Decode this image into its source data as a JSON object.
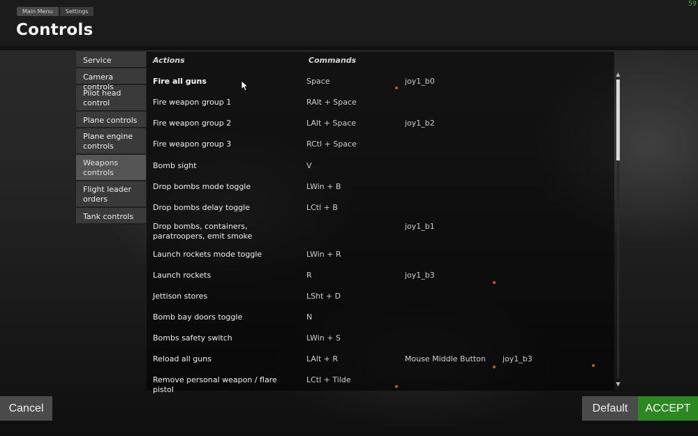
{
  "header": {
    "breadcrumbs": [
      "Main Menu",
      "Settings"
    ],
    "title": "Controls",
    "fps": "59"
  },
  "sidebar": {
    "items": [
      {
        "label": "Service"
      },
      {
        "label": "Camera controls"
      },
      {
        "label": "Pilot head control"
      },
      {
        "label": "Plane controls"
      },
      {
        "label": "Plane engine controls"
      },
      {
        "label": "Weapons controls"
      },
      {
        "label": "Flight leader orders"
      },
      {
        "label": "Tank controls"
      }
    ],
    "active": "Weapons controls"
  },
  "table": {
    "headers": {
      "actions": "Actions",
      "commands": "Commands"
    },
    "rows": [
      {
        "action": "Fire all guns",
        "command": "Space",
        "joy1": "joy1_b0",
        "joy2": ""
      },
      {
        "action": "Fire weapon group 1",
        "command": "RAlt + Space",
        "joy1": "",
        "joy2": ""
      },
      {
        "action": "Fire weapon group 2",
        "command": "LAlt + Space",
        "joy1": "joy1_b2",
        "joy2": ""
      },
      {
        "action": "Fire weapon group 3",
        "command": "RCtl + Space",
        "joy1": "",
        "joy2": ""
      },
      {
        "action": "Bomb sight",
        "command": "V",
        "joy1": "",
        "joy2": ""
      },
      {
        "action": "Drop bombs mode toggle",
        "command": "LWin + B",
        "joy1": "",
        "joy2": ""
      },
      {
        "action": "Drop bombs delay toggle",
        "command": "LCtl + B",
        "joy1": "",
        "joy2": ""
      },
      {
        "action": "Drop bombs, containers, paratroopers, emit smoke",
        "command": "",
        "joy1": "joy1_b1",
        "joy2": ""
      },
      {
        "action": "Launch rockets mode toggle",
        "command": "LWin + R",
        "joy1": "",
        "joy2": ""
      },
      {
        "action": "Launch rockets",
        "command": "R",
        "joy1": "joy1_b3",
        "joy2": ""
      },
      {
        "action": "Jettison stores",
        "command": "LSht + D",
        "joy1": "",
        "joy2": ""
      },
      {
        "action": "Bomb bay doors toggle",
        "command": "N",
        "joy1": "",
        "joy2": ""
      },
      {
        "action": "Bombs safety switch",
        "command": "LWin + S",
        "joy1": "",
        "joy2": ""
      },
      {
        "action": "Reload all guns",
        "command": "LAlt + R",
        "joy1": "Mouse Middle Button",
        "joy2": "joy1_b3"
      },
      {
        "action": "Remove personal weapon / flare pistol",
        "command": "LCtl + Tilde",
        "joy1": "",
        "joy2": ""
      }
    ]
  },
  "scrollbar": {
    "up_icon": "▲",
    "down_icon": "▼"
  },
  "footer": {
    "cancel": "Cancel",
    "default": "Default",
    "accept": "ACCEPT"
  },
  "colors": {
    "accept": "#2a8a1f",
    "marker": "#d2541e",
    "fps": "#3fae3f"
  }
}
